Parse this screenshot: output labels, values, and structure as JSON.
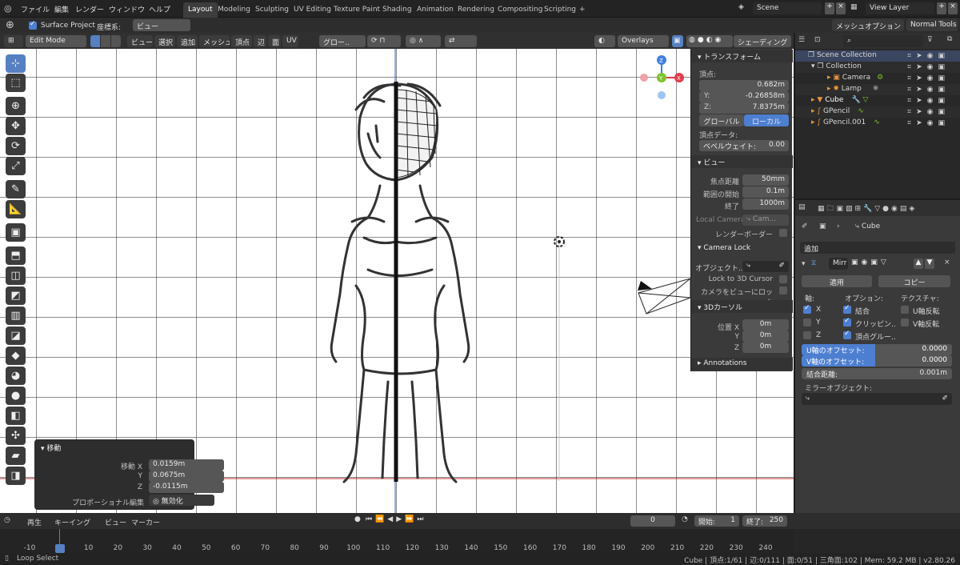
{
  "topbar": {
    "menus": [
      "ファイル",
      "編集",
      "レンダー",
      "ウィンドウ",
      "ヘルプ"
    ],
    "workspaces": [
      "Layout",
      "Modeling",
      "Sculpting",
      "UV Editing",
      "Texture Paint",
      "Shading",
      "Animation",
      "Rendering",
      "Compositing",
      "Scripting",
      "+"
    ],
    "active_workspace": "Layout",
    "scene": "Scene",
    "view_layer": "View Layer"
  },
  "tool_header": {
    "surface_project": "Surface Project",
    "coord_label": "座標系:",
    "coord_value": "ビュー",
    "mesh_options": "メッシュオプション",
    "normal_tools": "Normal Tools"
  },
  "viewport_header": {
    "mode": "Edit Mode",
    "menus": [
      "ビュー",
      "選択",
      "追加",
      "メッシュ",
      "頂点",
      "辺",
      "面",
      "UV"
    ],
    "transform_orient": "グロー..",
    "overlays": "Overlays",
    "shading": "シェーディング"
  },
  "npanel": {
    "transform_title": "トランスフォーム",
    "vertex_label": "頂点:",
    "x_label": "X:",
    "x_val": "0.682m",
    "y_label": "Y:",
    "y_val": "-0.26858m",
    "z_label": "Z:",
    "z_val": "7.8375m",
    "global": "グローバル",
    "local": "ローカル",
    "vertex_data": "頂点データ:",
    "bevel_label": "ベベルウェイト:",
    "bevel_val": "0.00",
    "view_title": "ビュー",
    "focal_label": "焦点距離",
    "focal_val": "50mm",
    "clip_start_label": "範囲の開始",
    "clip_start_val": "0.1m",
    "clip_end_label": "終了",
    "clip_end_val": "1000m",
    "local_camera_label": "Local Camera",
    "local_camera_val": "Cam...",
    "render_border": "レンダーボーダー",
    "camera_lock": "Camera Lock",
    "object_label": "オブジェクト..",
    "lock_cursor": "Lock to 3D Cursor",
    "lock_camera": "カメラをビューにロック",
    "cursor_title": "3Dカーソル",
    "loc_x_label": "位置 X",
    "loc_x_val": "0m",
    "loc_y_label": "Y",
    "loc_y_val": "0m",
    "loc_z_label": "Z",
    "loc_z_val": "0m",
    "annotations": "Annotations"
  },
  "op_panel": {
    "title": "移動",
    "mx_label": "移動 X",
    "mx_val": "0.0159m",
    "my_label": "Y",
    "my_val": "0.0675m",
    "mz_label": "Z",
    "mz_val": "-0.0115m",
    "prop_label": "プロポーショナル編集",
    "prop_val": "無効化"
  },
  "outliner": {
    "rows": [
      {
        "name": "Scene Collection"
      },
      {
        "name": "Collection"
      },
      {
        "name": "Camera"
      },
      {
        "name": "Lamp"
      },
      {
        "name": "Cube"
      },
      {
        "name": "GPencil"
      },
      {
        "name": "GPencil.001"
      }
    ]
  },
  "properties": {
    "object_name": "Cube",
    "add_modifier": "追加",
    "mod_name": "Mirr",
    "apply": "適用",
    "copy": "コピー",
    "axis_label": "軸:",
    "options_label": "オプション:",
    "texture_label": "テクスチャ:",
    "x": "X",
    "y": "Y",
    "z": "Z",
    "merge": "結合",
    "clipping": "クリッピン..",
    "vertex_group": "頂点グルー..",
    "u_flip": "U軸反転",
    "v_flip": "V軸反転",
    "u_offset_label": "U軸のオフセット:",
    "u_offset_val": "0.0000",
    "v_offset_label": "V軸のオフセット:",
    "v_offset_val": "0.0000",
    "merge_dist_label": "結合距離:",
    "merge_dist_val": "0.001m",
    "mirror_obj_label": "ミラーオブジェクト:"
  },
  "timeline": {
    "menus": [
      "再生",
      "キーイング",
      "ビュー",
      "マーカー"
    ],
    "current_frame": "0",
    "start_label": "開始:",
    "start_val": "1",
    "end_label": "終了:",
    "end_val": "250",
    "ticks": [
      "-10",
      "0",
      "10",
      "20",
      "30",
      "40",
      "50",
      "60",
      "70",
      "80",
      "90",
      "100",
      "110",
      "120",
      "130",
      "140",
      "150",
      "160",
      "170",
      "180",
      "190",
      "200",
      "210",
      "220",
      "230",
      "240"
    ]
  },
  "status": {
    "left": "Loop Select",
    "right": "Cube | 頂点:1/61 | 辺:0/111 | 面:0/51 | 三角面:102 | Mem: 59.2 MB | v2.80.26"
  },
  "colors": {
    "accent": "#5680c2",
    "axis_x": "#e23c4e",
    "axis_y": "#7fc42d",
    "axis_z": "#3f7fe0"
  }
}
